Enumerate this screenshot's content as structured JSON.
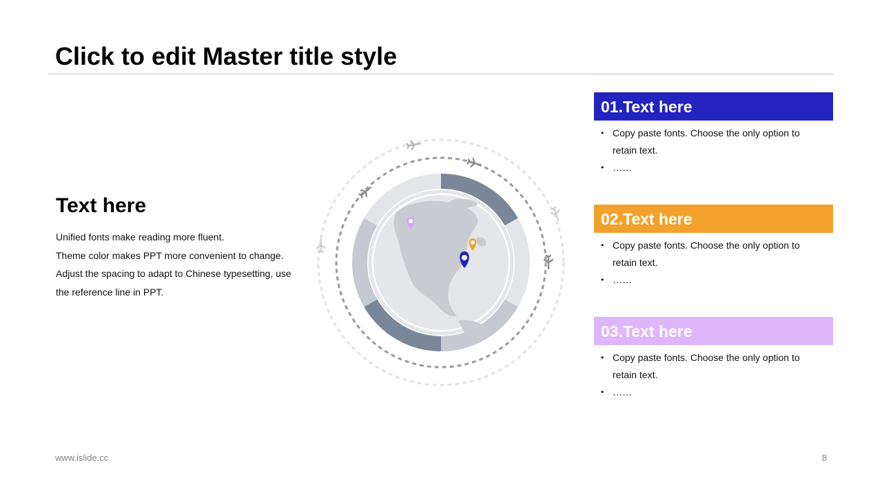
{
  "slide": {
    "title": "Click to edit Master title style",
    "footer_url": "www.islide.cc",
    "page_number": "8"
  },
  "left": {
    "heading": "Text here",
    "lines": [
      "Unified fonts make reading more fluent.",
      "Theme color makes PPT more convenient to change.",
      "Adjust the spacing to adapt to Chinese typesetting, use",
      "the reference line in PPT."
    ]
  },
  "cards": [
    {
      "title": "01.Text here",
      "color": "#2323c0",
      "bullets": [
        "Copy paste fonts. Choose the only option to",
        "retain text.",
        "……"
      ]
    },
    {
      "title": "02.Text here",
      "color": "#f2a22c",
      "bullets": [
        "Copy paste fonts. Choose the only option to",
        "retain text.",
        "……"
      ]
    },
    {
      "title": "03.Text here",
      "color": "#dfb5fb",
      "bullets": [
        "Copy paste fonts. Choose the only option to",
        "retain text.",
        "……"
      ]
    }
  ],
  "graphic": {
    "ring_dark": "#7a8799",
    "ring_mid": "#c5cad2",
    "ring_light": "#e3e5e8",
    "pins": [
      {
        "name": "pin-purple",
        "color": "#d4a6f8"
      },
      {
        "name": "pin-orange",
        "color": "#f2a22c"
      },
      {
        "name": "pin-blue",
        "color": "#2323c0"
      }
    ]
  }
}
